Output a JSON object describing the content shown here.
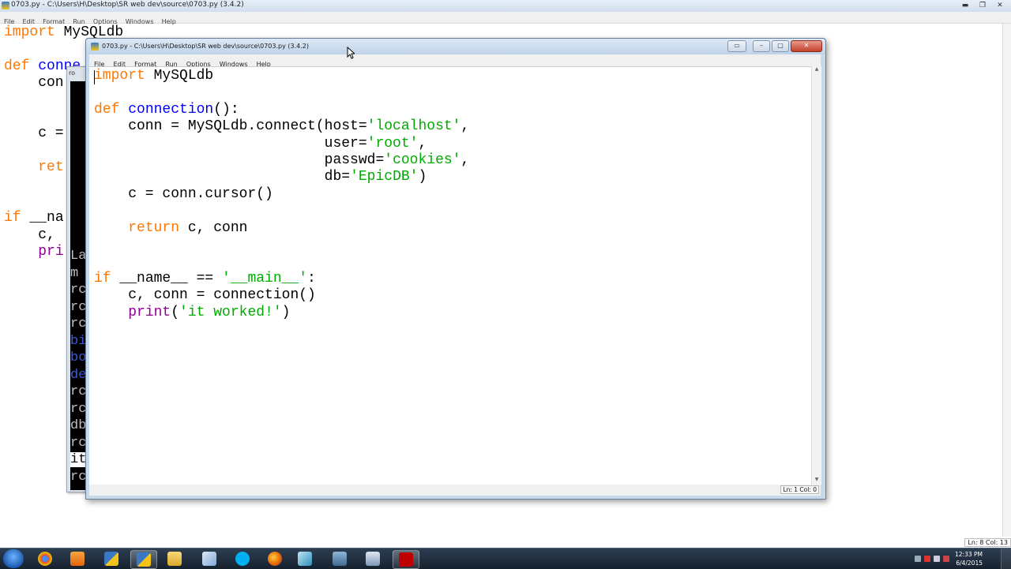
{
  "background_window": {
    "title": "0703.py - C:\\Users\\H\\Desktop\\SR web dev\\source\\0703.py (3.4.2)",
    "menu": [
      "File",
      "Edit",
      "Format",
      "Run",
      "Options",
      "Windows",
      "Help"
    ],
    "code_lines": [
      "import MySQLdb",
      "",
      "def conne",
      "    con",
      "",
      "",
      "    c =",
      "",
      "    ret",
      "",
      "",
      "if __na",
      "    c,",
      "    pri"
    ],
    "status": "Ln: 8  Col: 13"
  },
  "terminal": {
    "title": "ro",
    "lines": [
      "La",
      "m",
      "rc",
      "rc",
      "rc",
      "bi",
      "bo",
      "de",
      "rc",
      "rc",
      "db",
      "rc",
      "it",
      "rc"
    ]
  },
  "window": {
    "title": "0703.py - C:\\Users\\H\\Desktop\\SR web dev\\source\\0703.py (3.4.2)",
    "menu": [
      "File",
      "Edit",
      "Format",
      "Run",
      "Options",
      "Windows",
      "Help"
    ],
    "status": "Ln: 1  Col: 0",
    "code": {
      "l1_kw": "import",
      "l1_rest": " MySQLdb",
      "l3_kw": "def",
      "l3_fn": "connection",
      "l3_rest": "():",
      "l4_a": "    conn = MySQLdb.connect(host=",
      "l4_s": "'localhost'",
      "l4_b": ",",
      "l5_a": "                           user=",
      "l5_s": "'root'",
      "l5_b": ",",
      "l6_a": "                           passwd=",
      "l6_s": "'cookies'",
      "l6_b": ",",
      "l7_a": "                           db=",
      "l7_s": "'EpicDB'",
      "l7_b": ")",
      "l8": "    c = conn.cursor()",
      "l10_indent": "    ",
      "l10_kw": "return",
      "l10_rest": " c, conn",
      "l13_kw": "if",
      "l13_a": " __name__ == ",
      "l13_s": "'__main__'",
      "l13_b": ":",
      "l14": "    c, conn = connection()",
      "l15_indent": "    ",
      "l15_bi": "print",
      "l15_a": "(",
      "l15_s": "'it worked!'",
      "l15_b": ")"
    }
  },
  "taskbar": {
    "items": [
      "windows-explorer",
      "chrome",
      "media-player",
      "python-idle",
      "python-idle-active",
      "file-explorer",
      "notepad",
      "skype",
      "firefox",
      "notepad2",
      "network",
      "python-tool",
      "filezilla"
    ],
    "time": "12:33 PM",
    "date": "6/4/2015"
  }
}
